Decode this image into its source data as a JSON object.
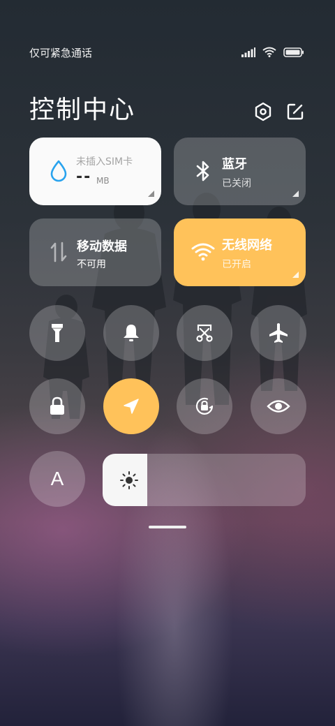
{
  "status": {
    "carrier_text": "仅可紧急通话",
    "icons": [
      "signal-icon",
      "wifi-icon",
      "battery-icon"
    ]
  },
  "header": {
    "title": "控制中心",
    "settings_icon": "settings-icon",
    "edit_icon": "edit-icon"
  },
  "tiles": {
    "data_usage": {
      "label": "未插入SIM卡",
      "value": "--",
      "unit": "MB",
      "icon": "water-drop-icon"
    },
    "bluetooth": {
      "label": "蓝牙",
      "status": "已关闭",
      "icon": "bluetooth-icon"
    },
    "mobile_data": {
      "label": "移动数据",
      "status": "不可用",
      "icon": "data-arrows-icon"
    },
    "wifi": {
      "label": "无线网络",
      "status": "已开启",
      "icon": "wifi-icon"
    }
  },
  "toggles": [
    {
      "name": "flashlight",
      "icon": "flashlight-icon",
      "active": false
    },
    {
      "name": "sound",
      "icon": "bell-icon",
      "active": false
    },
    {
      "name": "screenshot",
      "icon": "scissors-icon",
      "active": false
    },
    {
      "name": "airplane",
      "icon": "airplane-icon",
      "active": false
    },
    {
      "name": "lock",
      "icon": "lock-icon",
      "active": false
    },
    {
      "name": "location",
      "icon": "location-arrow-icon",
      "active": true
    },
    {
      "name": "rotation-lock",
      "icon": "rotation-lock-icon",
      "active": false
    },
    {
      "name": "reading-mode",
      "icon": "eye-icon",
      "active": false
    },
    {
      "name": "auto-brightness",
      "icon": "font-a-icon",
      "label": "A",
      "active": false
    }
  ],
  "brightness": {
    "level": 0.22,
    "icon": "sun-icon"
  },
  "colors": {
    "accent": "#ffc25a",
    "glass": "rgba(255,255,255,0.22)",
    "white_tile": "#fafafa",
    "drop_blue": "#29a3ee"
  }
}
